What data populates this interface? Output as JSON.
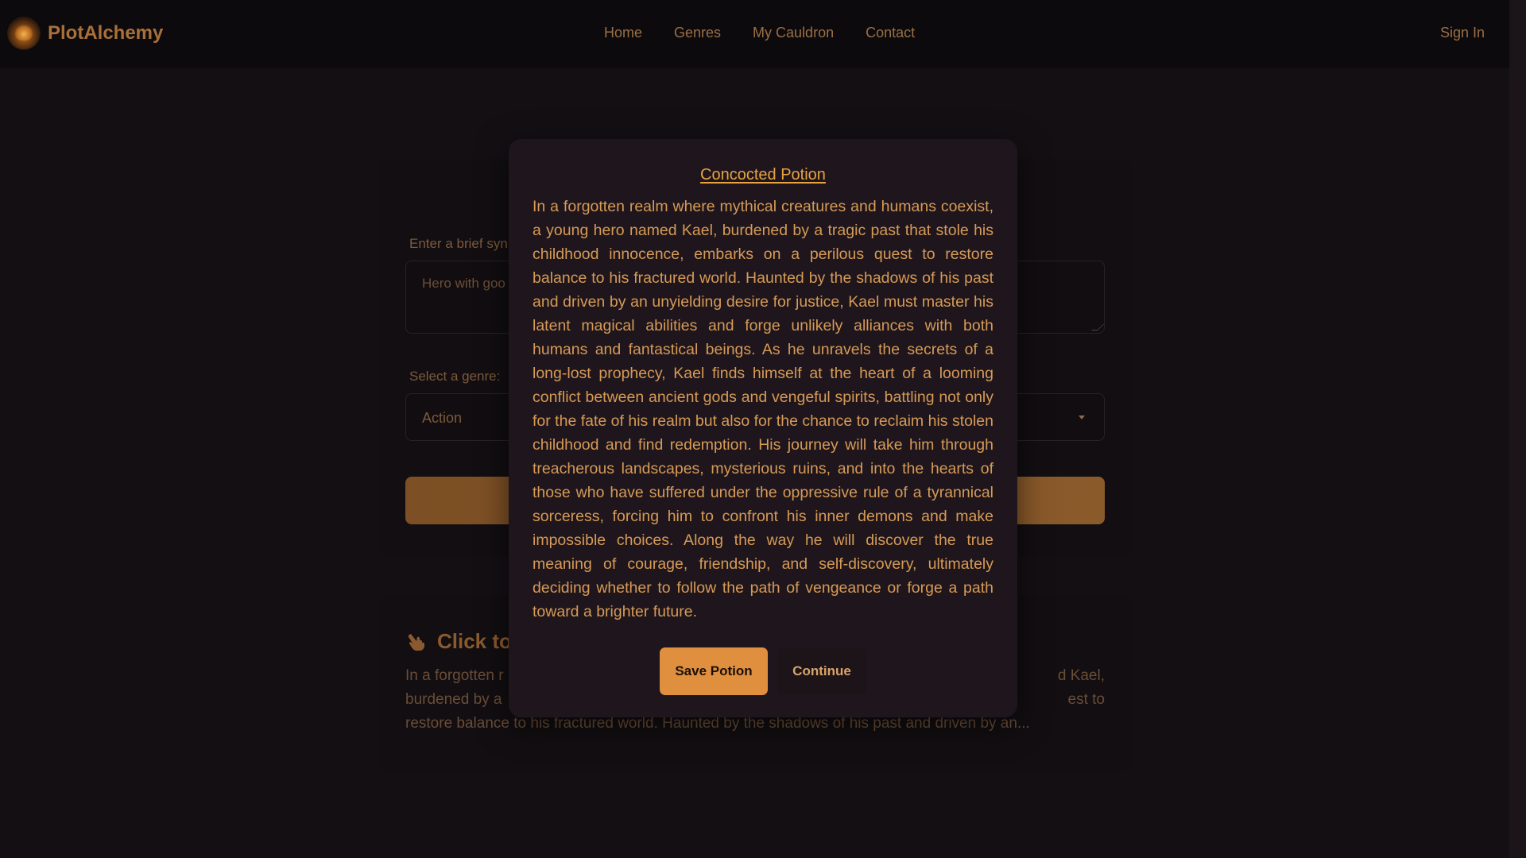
{
  "app": {
    "brand_name": "PlotAlchemy"
  },
  "nav": {
    "items": [
      "Home",
      "Genres",
      "My Cauldron",
      "Contact"
    ],
    "sign_in": "Sign In"
  },
  "form": {
    "synopsis_label": "Enter a brief syn",
    "synopsis_placeholder": "Hero with goo",
    "genre_label": "Select a genre:",
    "genre_selected": "Action"
  },
  "result": {
    "heading": "Click to",
    "lines": [
      {
        "left": "In a forgotten r",
        "right": "d Kael,"
      },
      {
        "left": "burdened by a",
        "right": "est to"
      },
      {
        "full": "restore balance to his fractured world. Haunted by the shadows of his past and driven by an..."
      }
    ]
  },
  "modal": {
    "title": "Concocted Potion",
    "body": "In a forgotten realm where mythical creatures and humans coexist, a young hero named Kael, burdened by a tragic past that stole his childhood innocence, embarks on a perilous quest to restore balance to his fractured world. Haunted by the shadows of his past and driven by an unyielding desire for justice, Kael must master his latent magical abilities and forge unlikely alliances with both humans and fantastical beings. As he unravels the secrets of a long-lost prophecy, Kael finds himself at the heart of a looming conflict between ancient gods and vengeful spirits, battling not only for the fate of his realm but also for the chance to reclaim his stolen childhood and find redemption. His journey will take him through treacherous landscapes, mysterious ruins, and into the hearts of those who have suffered under the oppressive rule of a tyrannical sorceress, forcing him to confront his inner demons and make impossible choices. Along the way he will discover the true meaning of courage, friendship, and self-discovery, ultimately deciding whether to follow the path of vengeance or forge a path toward a brighter future.",
    "save_label": "Save Potion",
    "continue_label": "Continue"
  },
  "colors": {
    "accent": "#e08f3e",
    "title": "#e6a341",
    "background": "#140f13",
    "modal_bg": "#1f161d"
  },
  "icons": {
    "brand": "cauldron-logo-icon",
    "result_heading": "pointing-hand-icon",
    "select": "chevron-down-icon"
  }
}
